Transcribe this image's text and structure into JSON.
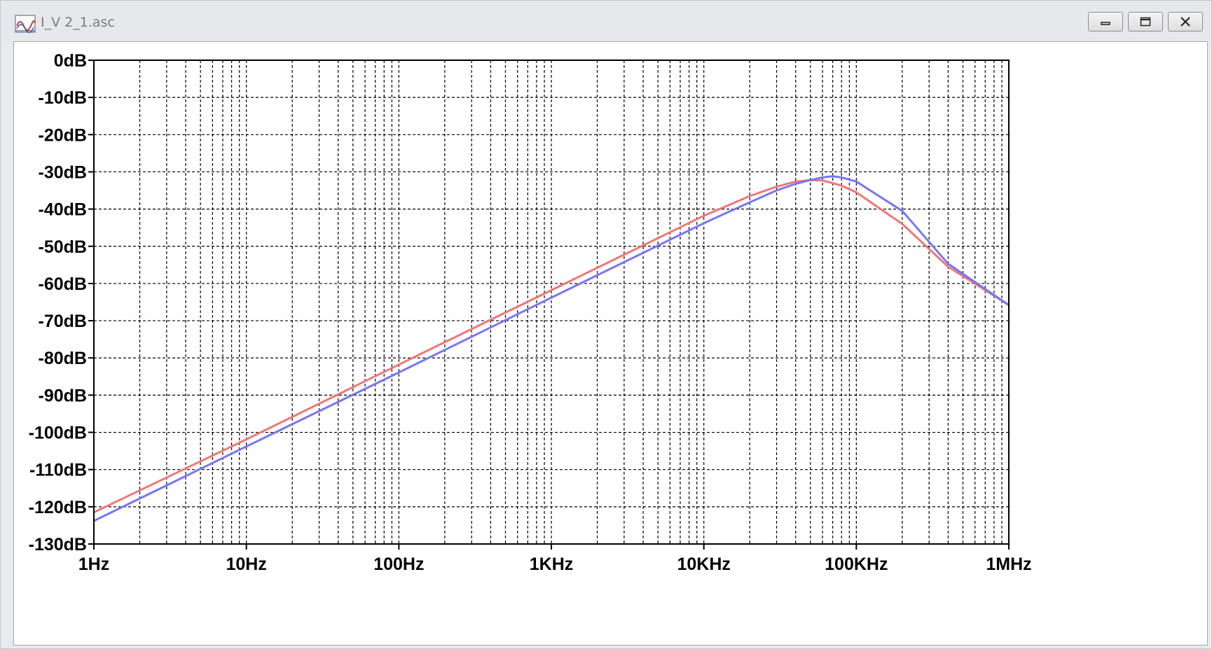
{
  "window": {
    "title": "I_V 2_1.asc",
    "app_icon": "ltspice-waveform-icon",
    "buttons": {
      "minimize_icon": "minimize-icon",
      "maximize_icon": "maximize-icon",
      "close_icon": "close-icon"
    }
  },
  "chart_data": {
    "type": "line",
    "title": "",
    "xlabel": "",
    "ylabel": "",
    "x_scale": "log",
    "xlim": [
      1,
      1000000
    ],
    "ylim": [
      -130,
      0
    ],
    "grid": true,
    "x_ticks": [
      {
        "value": 1,
        "label": "1Hz"
      },
      {
        "value": 10,
        "label": "10Hz"
      },
      {
        "value": 100,
        "label": "100Hz"
      },
      {
        "value": 1000,
        "label": "1KHz"
      },
      {
        "value": 10000,
        "label": "10KHz"
      },
      {
        "value": 100000,
        "label": "100KHz"
      },
      {
        "value": 1000000,
        "label": "1MHz"
      }
    ],
    "y_ticks": [
      {
        "value": 0,
        "label": "0dB"
      },
      {
        "value": -10,
        "label": "-10dB"
      },
      {
        "value": -20,
        "label": "-20dB"
      },
      {
        "value": -30,
        "label": "-30dB"
      },
      {
        "value": -40,
        "label": "-40dB"
      },
      {
        "value": -50,
        "label": "-50dB"
      },
      {
        "value": -60,
        "label": "-60dB"
      },
      {
        "value": -70,
        "label": "-70dB"
      },
      {
        "value": -80,
        "label": "-80dB"
      },
      {
        "value": -90,
        "label": "-90dB"
      },
      {
        "value": -100,
        "label": "-100dB"
      },
      {
        "value": -110,
        "label": "-110dB"
      },
      {
        "value": -120,
        "label": "-120dB"
      },
      {
        "value": -130,
        "label": "-130dB"
      }
    ],
    "colors": {
      "axes": "#000000",
      "grid": "#000000",
      "background": "#ffffff"
    },
    "series": [
      {
        "color": "#ee7777",
        "points": [
          [
            1,
            -121.5
          ],
          [
            10,
            -101.9
          ],
          [
            100,
            -81.8
          ],
          [
            1000,
            -61.8
          ],
          [
            10000,
            -41.8
          ],
          [
            20000,
            -36.5
          ],
          [
            30000,
            -34.0
          ],
          [
            40000,
            -32.6
          ],
          [
            50000,
            -32.2
          ],
          [
            60000,
            -32.3
          ],
          [
            80000,
            -33.7
          ],
          [
            100000,
            -35.5
          ],
          [
            200000,
            -44.0
          ],
          [
            400000,
            -55.5
          ],
          [
            700000,
            -61.8
          ],
          [
            1000000,
            -65.8
          ]
        ]
      },
      {
        "color": "#7777ee",
        "points": [
          [
            1,
            -123.8
          ],
          [
            10,
            -103.8
          ],
          [
            100,
            -83.9
          ],
          [
            1000,
            -63.8
          ],
          [
            10000,
            -43.8
          ],
          [
            20000,
            -38.2
          ],
          [
            30000,
            -35.0
          ],
          [
            40000,
            -33.2
          ],
          [
            50000,
            -32.2
          ],
          [
            60000,
            -31.5
          ],
          [
            70000,
            -31.2
          ],
          [
            80000,
            -31.5
          ],
          [
            100000,
            -32.6
          ],
          [
            200000,
            -40.5
          ],
          [
            400000,
            -54.7
          ],
          [
            700000,
            -61.5
          ],
          [
            1000000,
            -65.8
          ]
        ]
      }
    ]
  }
}
